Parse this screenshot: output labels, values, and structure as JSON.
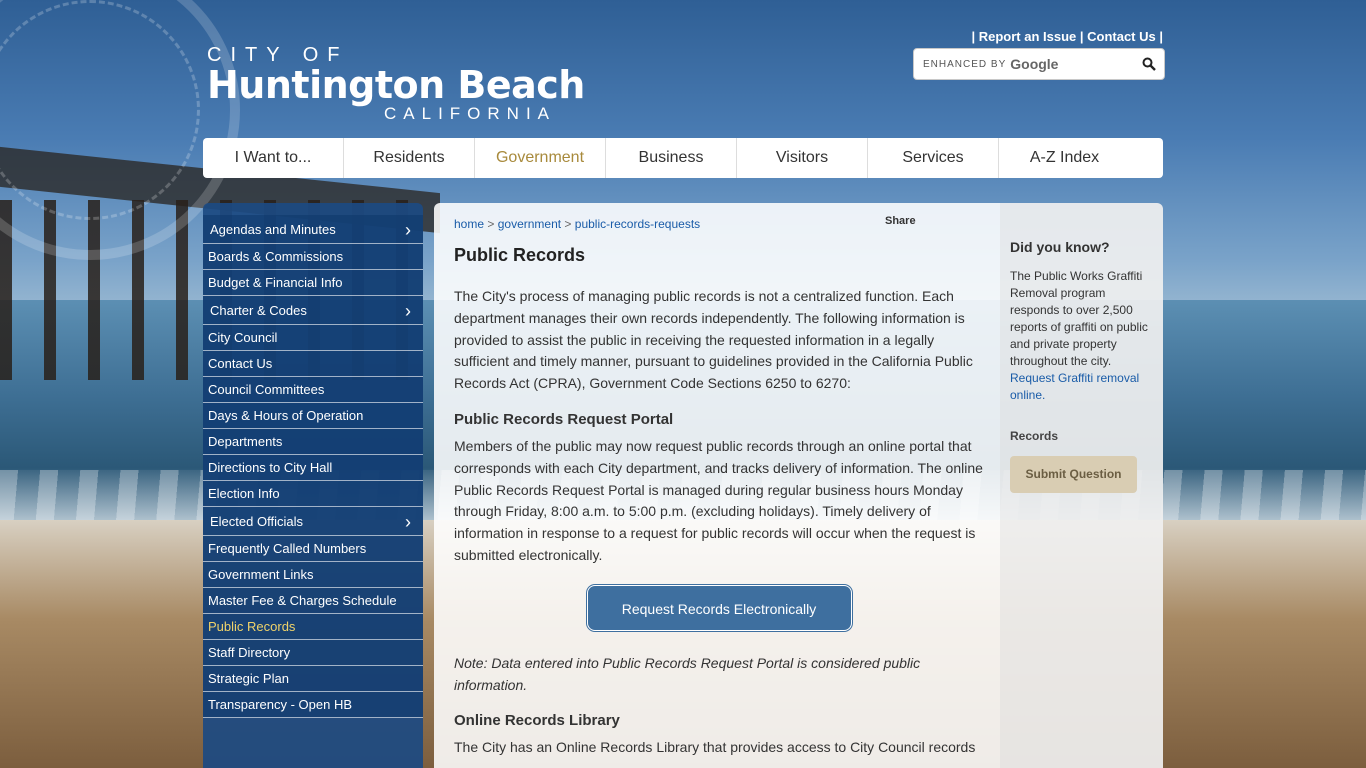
{
  "header": {
    "logo": {
      "line1": "CITY OF",
      "line2": "Huntington Beach",
      "line3": "CALIFORNIA"
    },
    "top_links": [
      "Report an Issue",
      "Contact Us"
    ],
    "search": {
      "enhanced_by": "ENHANCED BY",
      "provider": "Google",
      "placeholder": ""
    }
  },
  "nav": {
    "items": [
      "I Want to...",
      "Residents",
      "Government",
      "Business",
      "Visitors",
      "Services",
      "A-Z Index"
    ],
    "active": "Government"
  },
  "sidebar": {
    "items": [
      {
        "label": "Agendas and Minutes",
        "has_submenu": true
      },
      {
        "label": "Boards & Commissions",
        "has_submenu": false
      },
      {
        "label": "Budget & Financial Info",
        "has_submenu": false
      },
      {
        "label": "Charter & Codes",
        "has_submenu": true
      },
      {
        "label": "City Council",
        "has_submenu": false
      },
      {
        "label": "Contact Us",
        "has_submenu": false
      },
      {
        "label": "Council Committees",
        "has_submenu": false
      },
      {
        "label": "Days & Hours of Operation",
        "has_submenu": false
      },
      {
        "label": "Departments",
        "has_submenu": false
      },
      {
        "label": "Directions to City Hall",
        "has_submenu": false
      },
      {
        "label": "Election Info",
        "has_submenu": false
      },
      {
        "label": "Elected Officials",
        "has_submenu": true
      },
      {
        "label": "Frequently Called Numbers",
        "has_submenu": false
      },
      {
        "label": "Government Links",
        "has_submenu": false
      },
      {
        "label": "Master Fee & Charges Schedule",
        "has_submenu": false
      },
      {
        "label": "Public Records",
        "has_submenu": false,
        "active": true
      },
      {
        "label": "Staff Directory",
        "has_submenu": false
      },
      {
        "label": "Strategic Plan",
        "has_submenu": false
      },
      {
        "label": "Transparency - Open HB",
        "has_submenu": false
      }
    ]
  },
  "main": {
    "breadcrumb": [
      "home",
      "government",
      "public-records-requests"
    ],
    "share_label": "Share",
    "title": "Public Records",
    "intro": "The City's process of managing public records is not a centralized function. Each department manages their own records independently. The following information is provided to assist the public in receiving the requested information in a legally sufficient and timely manner, pursuant to guidelines provided in the California Public Records Act (CPRA), Government Code Sections 6250 to 6270:",
    "portal_heading": "Public Records Request Portal",
    "portal_text": "Members of the public may now request public records through an online portal that corresponds with each City department, and tracks delivery of information. The online Public Records Request Portal is managed during regular business hours Monday through Friday, 8:00 a.m. to 5:00 p.m. (excluding holidays). Timely delivery of information in response to a request for public records will occur when the request is submitted electronically.",
    "request_button": "Request Records Electronically",
    "note": "Note: Data entered into Public Records Request Portal is considered public information.",
    "library_heading": "Online Records Library",
    "library_text": "The City has an Online Records Library that provides access to City Council records"
  },
  "right": {
    "dyk_title": "Did you know?",
    "dyk_text": "The Public Works Graffiti Removal program responds to over 2,500 reports of graffiti on public and private property throughout the city.",
    "dyk_link": "Request Graffiti removal online.",
    "records_label": "Records",
    "submit_button": "Submit Question"
  },
  "colors": {
    "nav_active": "#a88a3c",
    "sidebar_bg": "#1c4a82",
    "sidebar_active": "#f0d36a",
    "button": "#3e6f9f"
  }
}
